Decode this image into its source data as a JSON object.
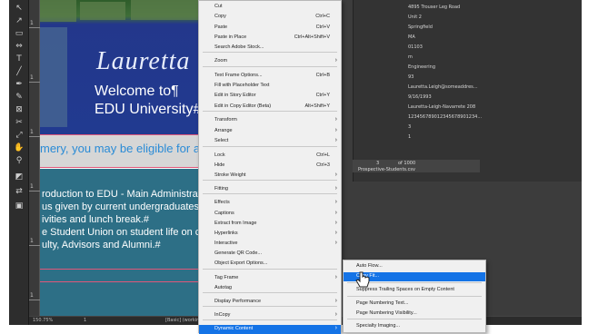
{
  "context_menu": {
    "items": [
      {
        "label": "Cut",
        "shortcut": ""
      },
      {
        "label": "Copy",
        "shortcut": "Ctrl+C"
      },
      {
        "label": "Paste",
        "shortcut": "Ctrl+V"
      },
      {
        "label": "Paste in Place",
        "shortcut": "Ctrl+Alt+Shift+V"
      },
      {
        "label": "Search Adobe Stock...",
        "shortcut": ""
      },
      {
        "label": "Zoom",
        "shortcut": ""
      },
      {
        "label": "Text Frame Options...",
        "shortcut": "Ctrl+B"
      },
      {
        "label": "Fill with Placeholder Text",
        "shortcut": ""
      },
      {
        "label": "Edit in Story Editor",
        "shortcut": "Ctrl+Y"
      },
      {
        "label": "Edit in Copy Editor (Beta)",
        "shortcut": "Alt+Shift+Y"
      },
      {
        "label": "Transform",
        "shortcut": ""
      },
      {
        "label": "Arrange",
        "shortcut": ""
      },
      {
        "label": "Select",
        "shortcut": ""
      },
      {
        "label": "Lock",
        "shortcut": "Ctrl+L"
      },
      {
        "label": "Hide",
        "shortcut": "Ctrl+3"
      },
      {
        "label": "Stroke Weight",
        "shortcut": ""
      },
      {
        "label": "Fitting",
        "shortcut": ""
      },
      {
        "label": "Effects",
        "shortcut": ""
      },
      {
        "label": "Captions",
        "shortcut": ""
      },
      {
        "label": "Extract from Image",
        "shortcut": ""
      },
      {
        "label": "Hyperlinks",
        "shortcut": ""
      },
      {
        "label": "Interactive",
        "shortcut": ""
      },
      {
        "label": "Generate QR Code...",
        "shortcut": ""
      },
      {
        "label": "Object Export Options...",
        "shortcut": ""
      },
      {
        "label": "Tag Frame",
        "shortcut": ""
      },
      {
        "label": "Autotag",
        "shortcut": ""
      },
      {
        "label": "Display Performance",
        "shortcut": ""
      },
      {
        "label": "InCopy",
        "shortcut": ""
      },
      {
        "label": "Dynamic Content",
        "shortcut": ""
      }
    ],
    "highlighted": "Dynamic Content"
  },
  "submenu": {
    "items": [
      {
        "label": "Auto Flow..."
      },
      {
        "label": "Copy Fit..."
      },
      {
        "label": "Suppress Trailing Spaces on Empty Content"
      },
      {
        "label": "Page Numbering Text..."
      },
      {
        "label": "Page Numbering Visibility..."
      },
      {
        "label": "Specialty Imaging..."
      }
    ],
    "highlighted": "Copy Fit..."
  },
  "document": {
    "name_script": "Lauretta",
    "heading1": "Welcome to¶",
    "heading2": "EDU University#",
    "eligible_line": "mery, you may be eligible for a sc",
    "bullets": [
      "roduction to EDU - Main Administration",
      "us given by current undergraduates.#",
      "ivities and lunch break.#",
      "e Student Union on student life on car",
      "ulty, Advisors and Alumni.#"
    ]
  },
  "data_panel": {
    "values": [
      "4895 Trouser Leg Road",
      "Unit 2",
      "Springfield",
      "MA",
      "01103",
      "m",
      "Engineering",
      "93",
      "Lauretta.Leigh@someaddres...",
      "9/16/1993",
      "Lauretta-Leigh-Navarrete 208",
      "123456789012345678901234...",
      "3",
      "1"
    ],
    "record_current": "3",
    "record_total": "of 1000",
    "source_file": "Prospective-Students.csv"
  },
  "status_bar": {
    "zoom": "150.75%",
    "page": "1",
    "style": "[Basic] (working)"
  },
  "toolbox_icons": [
    "selection-icon",
    "direct-selection-icon",
    "page-icon",
    "gap-icon",
    "type-icon",
    "line-icon",
    "pen-icon",
    "pencil-icon",
    "rectangle-frame-icon",
    "rectangle-icon",
    "scissors-icon",
    "free-transform-icon",
    "gradient-icon",
    "note-icon",
    "eyedropper-icon",
    "hand-icon",
    "zoom-icon",
    "fill-stroke-icon",
    "swap-icon",
    "mode-icon"
  ],
  "colors": {
    "menu_highlight": "#1473e6",
    "eligible_text": "#2a8bd6",
    "teal_band": "#2d6f86"
  }
}
